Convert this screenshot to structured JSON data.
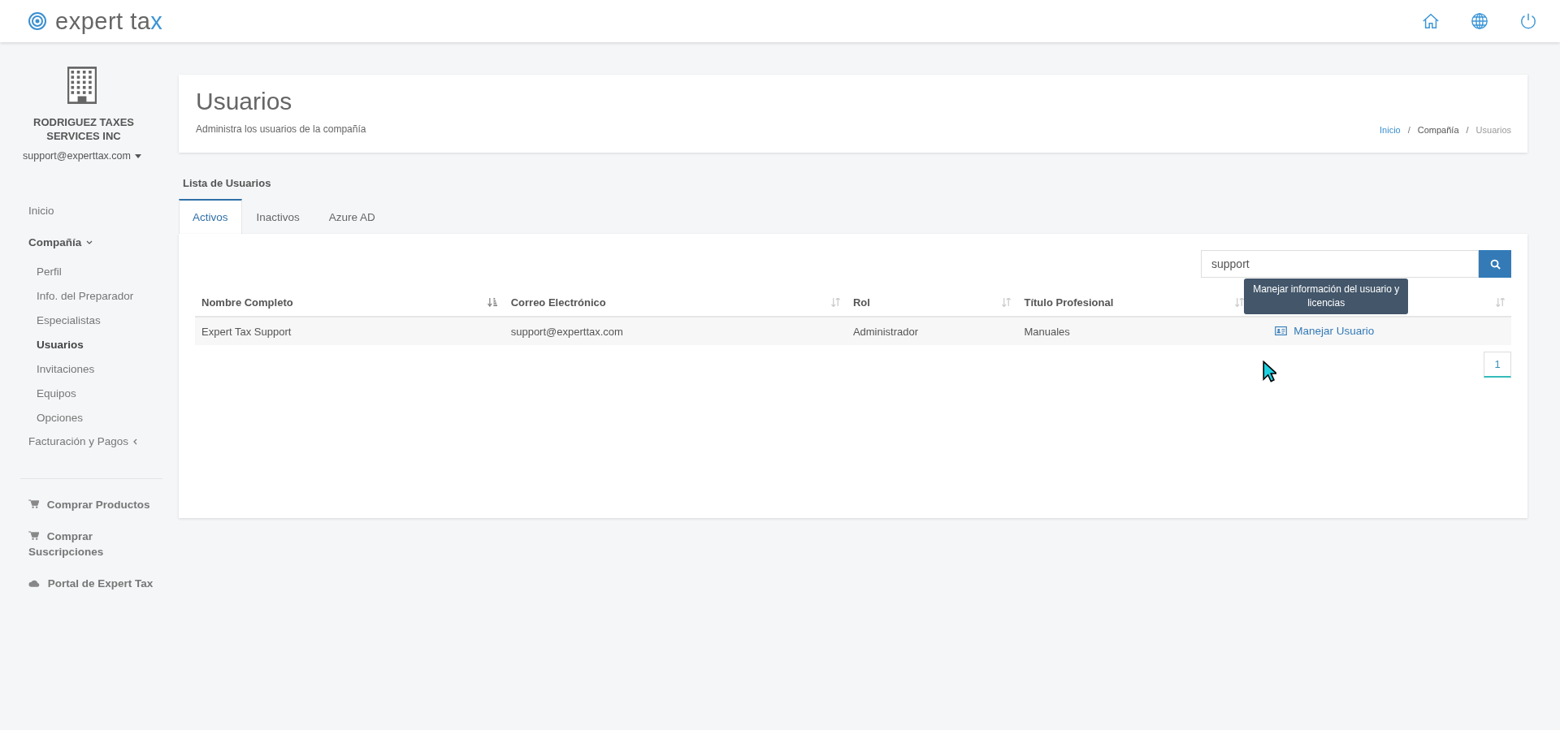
{
  "logo": {
    "text": "expert ta",
    "accent": "x"
  },
  "company": {
    "name": "RODRIGUEZ TAXES SERVICES INC",
    "account": "support@experttax.com"
  },
  "sidebar": {
    "items": [
      {
        "kind": "link",
        "label": "Inicio",
        "selected": false
      },
      {
        "kind": "group",
        "label": "Compañía",
        "expanded": true,
        "children": [
          {
            "label": "Perfil",
            "selected": false
          },
          {
            "label": "Info. del Preparador",
            "selected": false
          },
          {
            "label": "Especialistas",
            "selected": false
          },
          {
            "label": "Usuarios",
            "selected": true
          },
          {
            "label": "Invitaciones",
            "selected": false
          },
          {
            "label": "Equipos",
            "selected": false
          },
          {
            "label": "Opciones",
            "selected": false
          }
        ]
      },
      {
        "kind": "group",
        "label": "Facturación y Pagos",
        "expanded": false
      }
    ],
    "extra_links": [
      {
        "kind": "cart",
        "label": "Comprar Productos"
      },
      {
        "kind": "cart",
        "label": "Comprar Suscripciones"
      },
      {
        "kind": "cloud",
        "label": "Portal de Expert Tax"
      }
    ]
  },
  "header": {
    "title": "Usuarios",
    "subtitle": "Administra los usuarios de la compañía",
    "breadcrumb_separator": "/",
    "breadcrumb": [
      {
        "label": "Inicio",
        "kind": "link"
      },
      {
        "label": "Compañía",
        "kind": "text"
      },
      {
        "label": "Usuarios",
        "kind": "current"
      }
    ]
  },
  "section_title": "Lista de Usuarios",
  "tabs": [
    {
      "label": "Activos",
      "selected": true
    },
    {
      "label": "Inactivos",
      "selected": false
    },
    {
      "label": "Azure AD",
      "selected": false
    }
  ],
  "search": {
    "value": "support"
  },
  "table": {
    "columns": [
      {
        "label": "Nombre Completo",
        "sorted": true
      },
      {
        "label": "Correo Electrónico",
        "sorted": false
      },
      {
        "label": "Rol",
        "sorted": false
      },
      {
        "label": "Título Profesional",
        "sorted": false
      },
      {
        "sorted": false
      }
    ],
    "rows": [
      {
        "cells": [
          "Expert Tax Support",
          "support@experttax.com",
          "Administrador",
          "Manuales"
        ],
        "action": "Manejar Usuario"
      }
    ]
  },
  "tooltip": "Manejar información del usuario y licencias",
  "pagination": [
    {
      "label": "1",
      "selected": true
    }
  ]
}
